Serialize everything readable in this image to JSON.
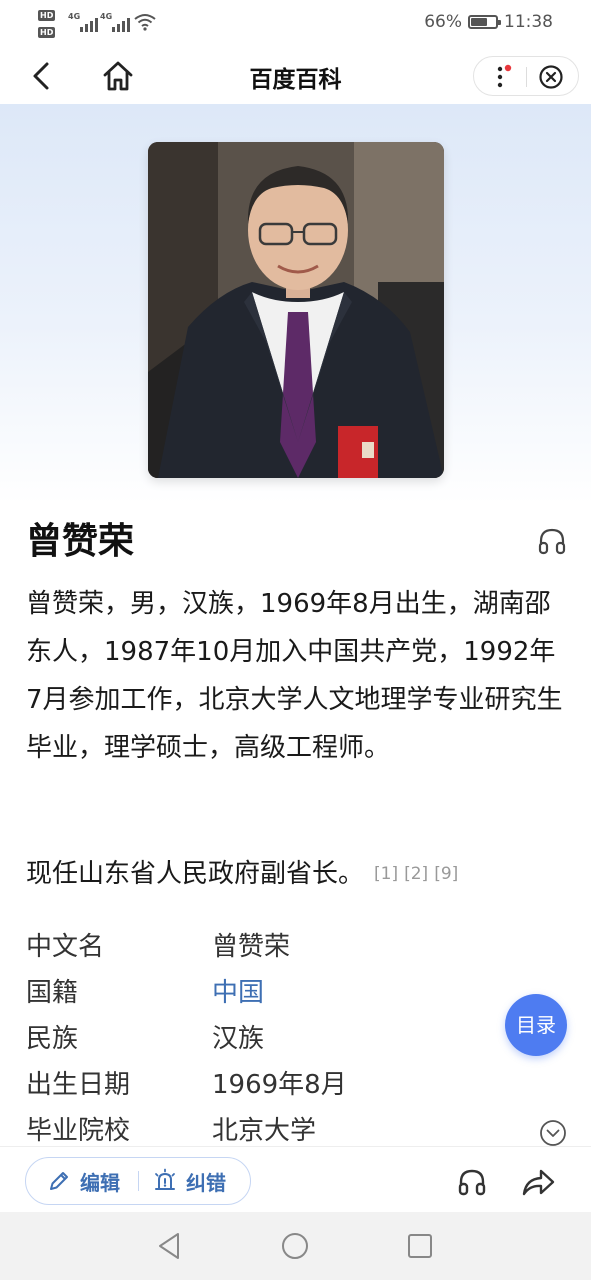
{
  "status_bar": {
    "hd_label": "HD",
    "network_label": "4G",
    "battery": "66%",
    "battery_level": 0.66,
    "time": "11:38"
  },
  "nav": {
    "title": "百度百科"
  },
  "article": {
    "name": "曾赞荣",
    "summary": "曾赞荣，男，汉族，1969年8月出生，湖南邵东人，1987年10月加入中国共产党，1992年7月参加工作，北京大学人文地理学专业研究生毕业，理学硕士，高级工程师。",
    "current_position": "现任山东省人民政府副省长。",
    "references": [
      "[1]",
      "[2]",
      "[9]"
    ]
  },
  "info_box": [
    {
      "key": "中文名",
      "value": "曾赞荣"
    },
    {
      "key": "国籍",
      "value": "中国"
    },
    {
      "key": "民族",
      "value": "汉族"
    },
    {
      "key": "出生日期",
      "value": "1969年8月"
    },
    {
      "key": "毕业院校",
      "value": "北京大学"
    }
  ],
  "toc_button": "目录",
  "toolbar": {
    "edit_label": "编辑",
    "fix_label": "纠错"
  },
  "colors": {
    "accent": "#4e7cf1",
    "link": "#3e6fb3",
    "notification_dot": "#e8383d"
  },
  "icons": [
    "back-arrow-icon",
    "home-icon",
    "more-icon",
    "close-circle-icon",
    "headphones-icon",
    "chevron-down-icon",
    "pencil-icon",
    "report-icon",
    "share-icon"
  ]
}
